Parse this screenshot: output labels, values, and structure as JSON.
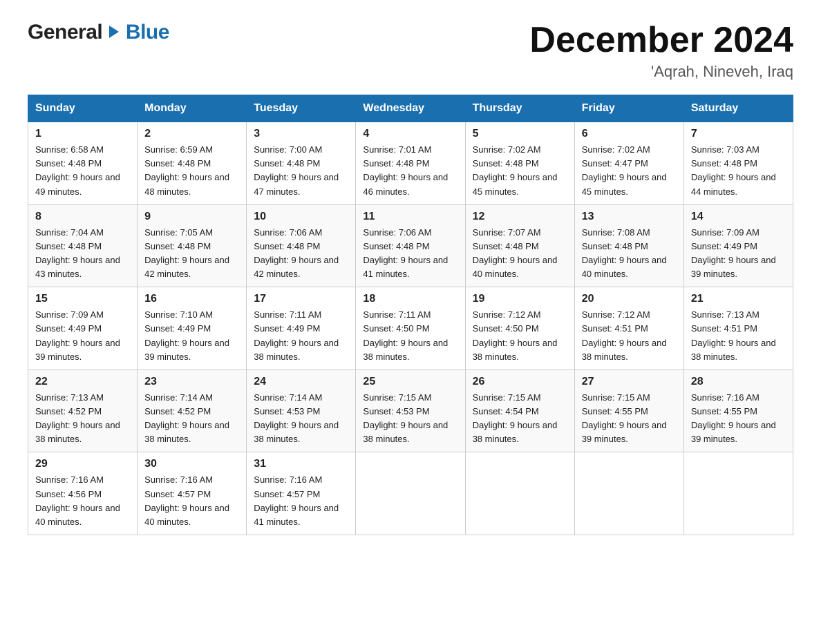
{
  "header": {
    "logo_general": "General",
    "logo_blue": "Blue",
    "month_title": "December 2024",
    "location": "'Aqrah, Nineveh, Iraq"
  },
  "columns": [
    "Sunday",
    "Monday",
    "Tuesday",
    "Wednesday",
    "Thursday",
    "Friday",
    "Saturday"
  ],
  "weeks": [
    [
      {
        "day": "1",
        "sunrise": "Sunrise: 6:58 AM",
        "sunset": "Sunset: 4:48 PM",
        "daylight": "Daylight: 9 hours and 49 minutes."
      },
      {
        "day": "2",
        "sunrise": "Sunrise: 6:59 AM",
        "sunset": "Sunset: 4:48 PM",
        "daylight": "Daylight: 9 hours and 48 minutes."
      },
      {
        "day": "3",
        "sunrise": "Sunrise: 7:00 AM",
        "sunset": "Sunset: 4:48 PM",
        "daylight": "Daylight: 9 hours and 47 minutes."
      },
      {
        "day": "4",
        "sunrise": "Sunrise: 7:01 AM",
        "sunset": "Sunset: 4:48 PM",
        "daylight": "Daylight: 9 hours and 46 minutes."
      },
      {
        "day": "5",
        "sunrise": "Sunrise: 7:02 AM",
        "sunset": "Sunset: 4:48 PM",
        "daylight": "Daylight: 9 hours and 45 minutes."
      },
      {
        "day": "6",
        "sunrise": "Sunrise: 7:02 AM",
        "sunset": "Sunset: 4:47 PM",
        "daylight": "Daylight: 9 hours and 45 minutes."
      },
      {
        "day": "7",
        "sunrise": "Sunrise: 7:03 AM",
        "sunset": "Sunset: 4:48 PM",
        "daylight": "Daylight: 9 hours and 44 minutes."
      }
    ],
    [
      {
        "day": "8",
        "sunrise": "Sunrise: 7:04 AM",
        "sunset": "Sunset: 4:48 PM",
        "daylight": "Daylight: 9 hours and 43 minutes."
      },
      {
        "day": "9",
        "sunrise": "Sunrise: 7:05 AM",
        "sunset": "Sunset: 4:48 PM",
        "daylight": "Daylight: 9 hours and 42 minutes."
      },
      {
        "day": "10",
        "sunrise": "Sunrise: 7:06 AM",
        "sunset": "Sunset: 4:48 PM",
        "daylight": "Daylight: 9 hours and 42 minutes."
      },
      {
        "day": "11",
        "sunrise": "Sunrise: 7:06 AM",
        "sunset": "Sunset: 4:48 PM",
        "daylight": "Daylight: 9 hours and 41 minutes."
      },
      {
        "day": "12",
        "sunrise": "Sunrise: 7:07 AM",
        "sunset": "Sunset: 4:48 PM",
        "daylight": "Daylight: 9 hours and 40 minutes."
      },
      {
        "day": "13",
        "sunrise": "Sunrise: 7:08 AM",
        "sunset": "Sunset: 4:48 PM",
        "daylight": "Daylight: 9 hours and 40 minutes."
      },
      {
        "day": "14",
        "sunrise": "Sunrise: 7:09 AM",
        "sunset": "Sunset: 4:49 PM",
        "daylight": "Daylight: 9 hours and 39 minutes."
      }
    ],
    [
      {
        "day": "15",
        "sunrise": "Sunrise: 7:09 AM",
        "sunset": "Sunset: 4:49 PM",
        "daylight": "Daylight: 9 hours and 39 minutes."
      },
      {
        "day": "16",
        "sunrise": "Sunrise: 7:10 AM",
        "sunset": "Sunset: 4:49 PM",
        "daylight": "Daylight: 9 hours and 39 minutes."
      },
      {
        "day": "17",
        "sunrise": "Sunrise: 7:11 AM",
        "sunset": "Sunset: 4:49 PM",
        "daylight": "Daylight: 9 hours and 38 minutes."
      },
      {
        "day": "18",
        "sunrise": "Sunrise: 7:11 AM",
        "sunset": "Sunset: 4:50 PM",
        "daylight": "Daylight: 9 hours and 38 minutes."
      },
      {
        "day": "19",
        "sunrise": "Sunrise: 7:12 AM",
        "sunset": "Sunset: 4:50 PM",
        "daylight": "Daylight: 9 hours and 38 minutes."
      },
      {
        "day": "20",
        "sunrise": "Sunrise: 7:12 AM",
        "sunset": "Sunset: 4:51 PM",
        "daylight": "Daylight: 9 hours and 38 minutes."
      },
      {
        "day": "21",
        "sunrise": "Sunrise: 7:13 AM",
        "sunset": "Sunset: 4:51 PM",
        "daylight": "Daylight: 9 hours and 38 minutes."
      }
    ],
    [
      {
        "day": "22",
        "sunrise": "Sunrise: 7:13 AM",
        "sunset": "Sunset: 4:52 PM",
        "daylight": "Daylight: 9 hours and 38 minutes."
      },
      {
        "day": "23",
        "sunrise": "Sunrise: 7:14 AM",
        "sunset": "Sunset: 4:52 PM",
        "daylight": "Daylight: 9 hours and 38 minutes."
      },
      {
        "day": "24",
        "sunrise": "Sunrise: 7:14 AM",
        "sunset": "Sunset: 4:53 PM",
        "daylight": "Daylight: 9 hours and 38 minutes."
      },
      {
        "day": "25",
        "sunrise": "Sunrise: 7:15 AM",
        "sunset": "Sunset: 4:53 PM",
        "daylight": "Daylight: 9 hours and 38 minutes."
      },
      {
        "day": "26",
        "sunrise": "Sunrise: 7:15 AM",
        "sunset": "Sunset: 4:54 PM",
        "daylight": "Daylight: 9 hours and 38 minutes."
      },
      {
        "day": "27",
        "sunrise": "Sunrise: 7:15 AM",
        "sunset": "Sunset: 4:55 PM",
        "daylight": "Daylight: 9 hours and 39 minutes."
      },
      {
        "day": "28",
        "sunrise": "Sunrise: 7:16 AM",
        "sunset": "Sunset: 4:55 PM",
        "daylight": "Daylight: 9 hours and 39 minutes."
      }
    ],
    [
      {
        "day": "29",
        "sunrise": "Sunrise: 7:16 AM",
        "sunset": "Sunset: 4:56 PM",
        "daylight": "Daylight: 9 hours and 40 minutes."
      },
      {
        "day": "30",
        "sunrise": "Sunrise: 7:16 AM",
        "sunset": "Sunset: 4:57 PM",
        "daylight": "Daylight: 9 hours and 40 minutes."
      },
      {
        "day": "31",
        "sunrise": "Sunrise: 7:16 AM",
        "sunset": "Sunset: 4:57 PM",
        "daylight": "Daylight: 9 hours and 41 minutes."
      },
      null,
      null,
      null,
      null
    ]
  ]
}
